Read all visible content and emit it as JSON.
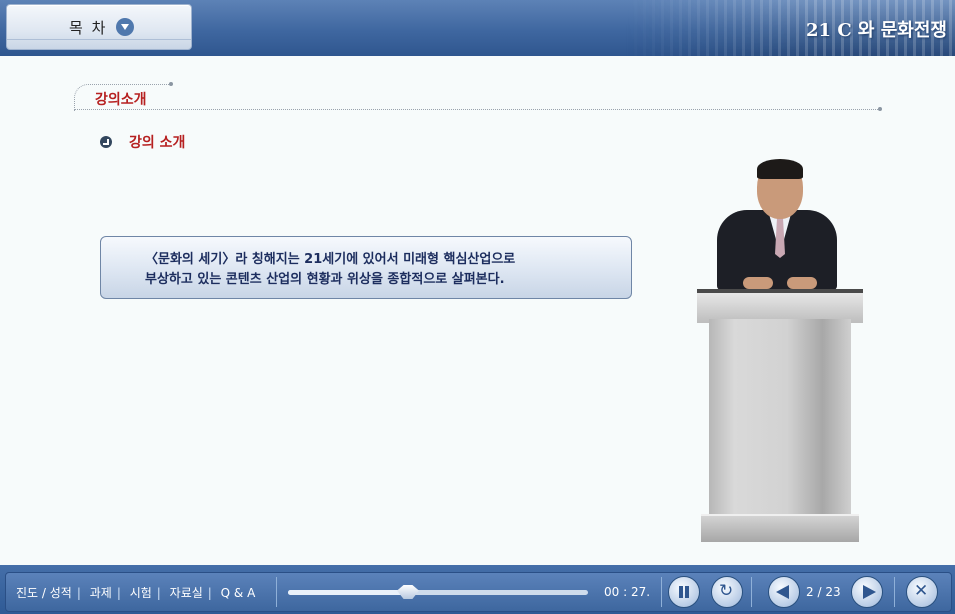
{
  "header": {
    "toc_label": "목 차",
    "course_title": "21 C 와 문화전쟁"
  },
  "content": {
    "section_title": "강의소개",
    "sub_heading": "강의 소개",
    "description": [
      "〈문화의 세기〉라 칭해지는 21세기에 있어서 미래형 핵심산업으로",
      "부상하고 있는 콘텐츠 산업의 현황과 위상을 종합적으로 살펴본다."
    ]
  },
  "player": {
    "nav": [
      "진도 / 성적",
      "과제",
      "시험",
      "자료실",
      "Q & A"
    ],
    "time": "00 : 27.",
    "progress_fraction": 0.4,
    "page_current": "2",
    "page_total": "23"
  },
  "colors": {
    "header_blue": "#3f67a0",
    "accent_red": "#b62020",
    "box_text": "#1c2d5e"
  },
  "icons": [
    "chevron-down-icon",
    "bullet-arrow-icon",
    "pause-icon",
    "replay-icon",
    "prev-icon",
    "next-icon",
    "close-icon"
  ]
}
